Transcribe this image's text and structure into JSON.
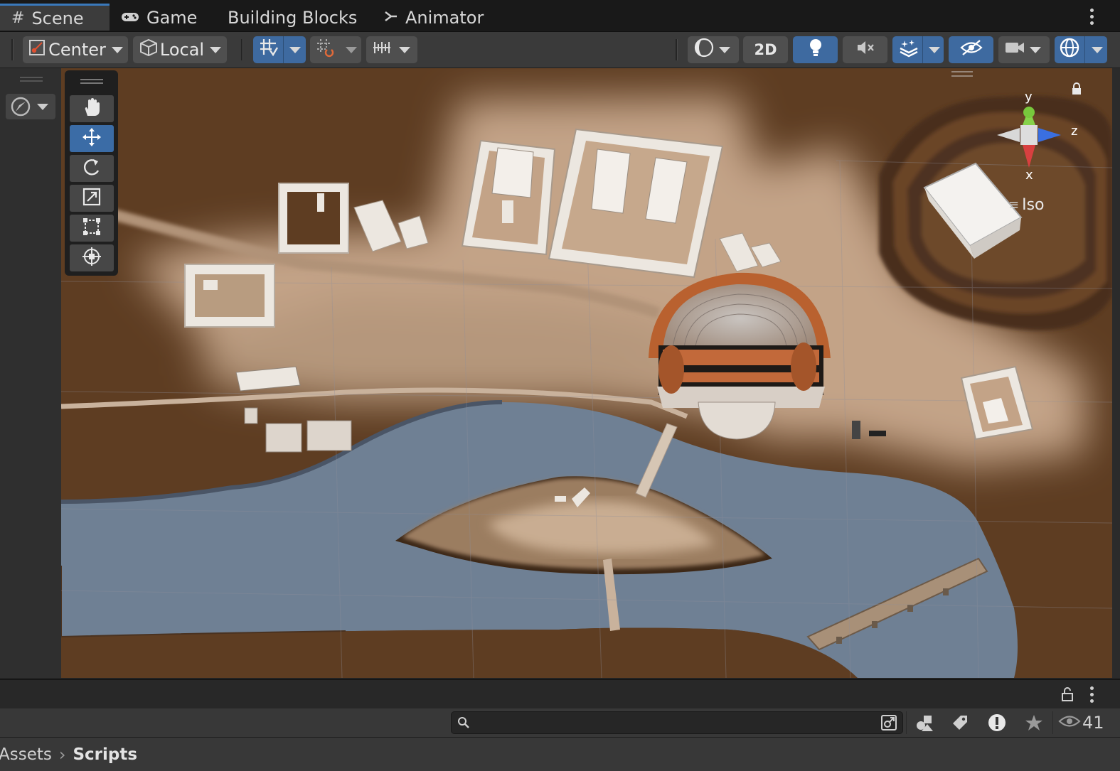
{
  "tabs": [
    {
      "label": "Scene",
      "icon": "hash-grid-icon",
      "active": true
    },
    {
      "label": "Game",
      "icon": "gamepad-icon",
      "active": false
    },
    {
      "label": "Building Blocks",
      "icon": "",
      "active": false
    },
    {
      "label": "Animator",
      "icon": "animator-icon",
      "active": false
    }
  ],
  "toolbar": {
    "pivot_mode": "Center",
    "pivot_rotation": "Local",
    "view_2d": "2D"
  },
  "gizmo": {
    "y_label": "y",
    "z_label": "z",
    "x_label": "x",
    "projection": "Iso"
  },
  "search": {
    "placeholder": ""
  },
  "visibility_count": "41",
  "breadcrumb": {
    "root": "Assets",
    "separator": "›",
    "current": "Scripts"
  },
  "colors": {
    "accent": "#3e6aa0",
    "ground": "#5e3d22",
    "water": "#6f8094",
    "sand": "#c9ad91",
    "building": "#ece7e0",
    "theatre": "#b9612f"
  }
}
